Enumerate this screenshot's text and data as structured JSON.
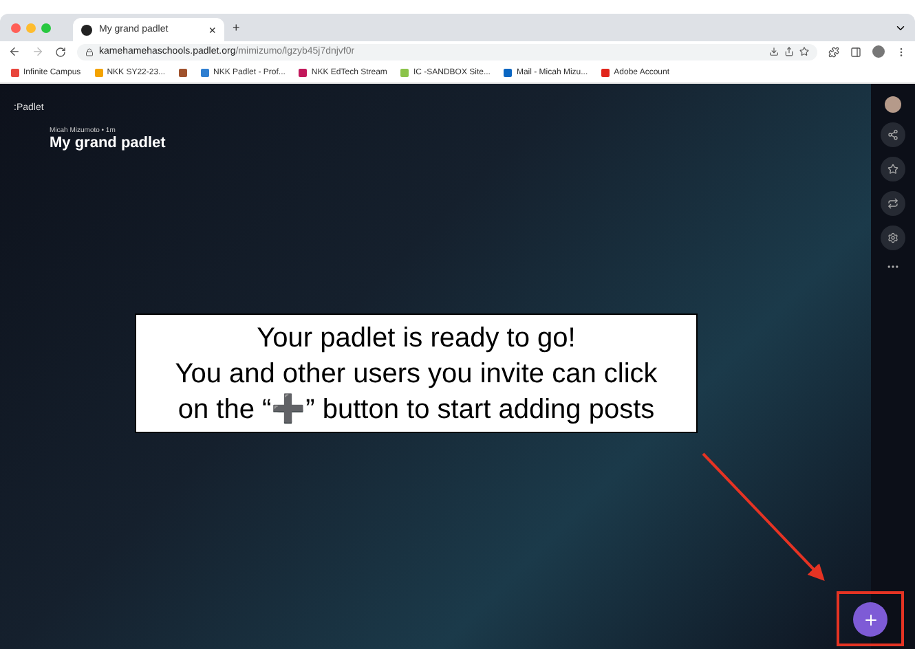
{
  "browser": {
    "tab": {
      "title": "My grand padlet",
      "close": "×",
      "selected": true
    },
    "new_tab": "+",
    "url": {
      "host": "kamehamehaschools.padlet.org",
      "path": "/mimizumo/lgzyb45j7dnjvf0r"
    },
    "bookmarks": [
      {
        "label": "Infinite Campus",
        "color": "#e8453c"
      },
      {
        "label": "NKK SY22-23...",
        "color": "#f4a300"
      },
      {
        "color": "#a0522d"
      },
      {
        "label": "NKK Padlet - Prof...",
        "color": "#2f7fd1"
      },
      {
        "label": "NKK EdTech Stream",
        "color": "#c2185b"
      },
      {
        "label": "IC -SANDBOX Site...",
        "color": "#8bc34a"
      },
      {
        "label": "Mail - Micah Mizu...",
        "color": "#0a66c2"
      },
      {
        "label": "Adobe Account",
        "color": "#e1251b"
      }
    ]
  },
  "padlet": {
    "logo": ":Padlet",
    "meta": "Micah Mizumoto • 1m",
    "title": "My grand padlet"
  },
  "callout": [
    "Your padlet is ready to go!",
    "You and other users you invite can click",
    "on the “➕” button to start adding posts"
  ]
}
